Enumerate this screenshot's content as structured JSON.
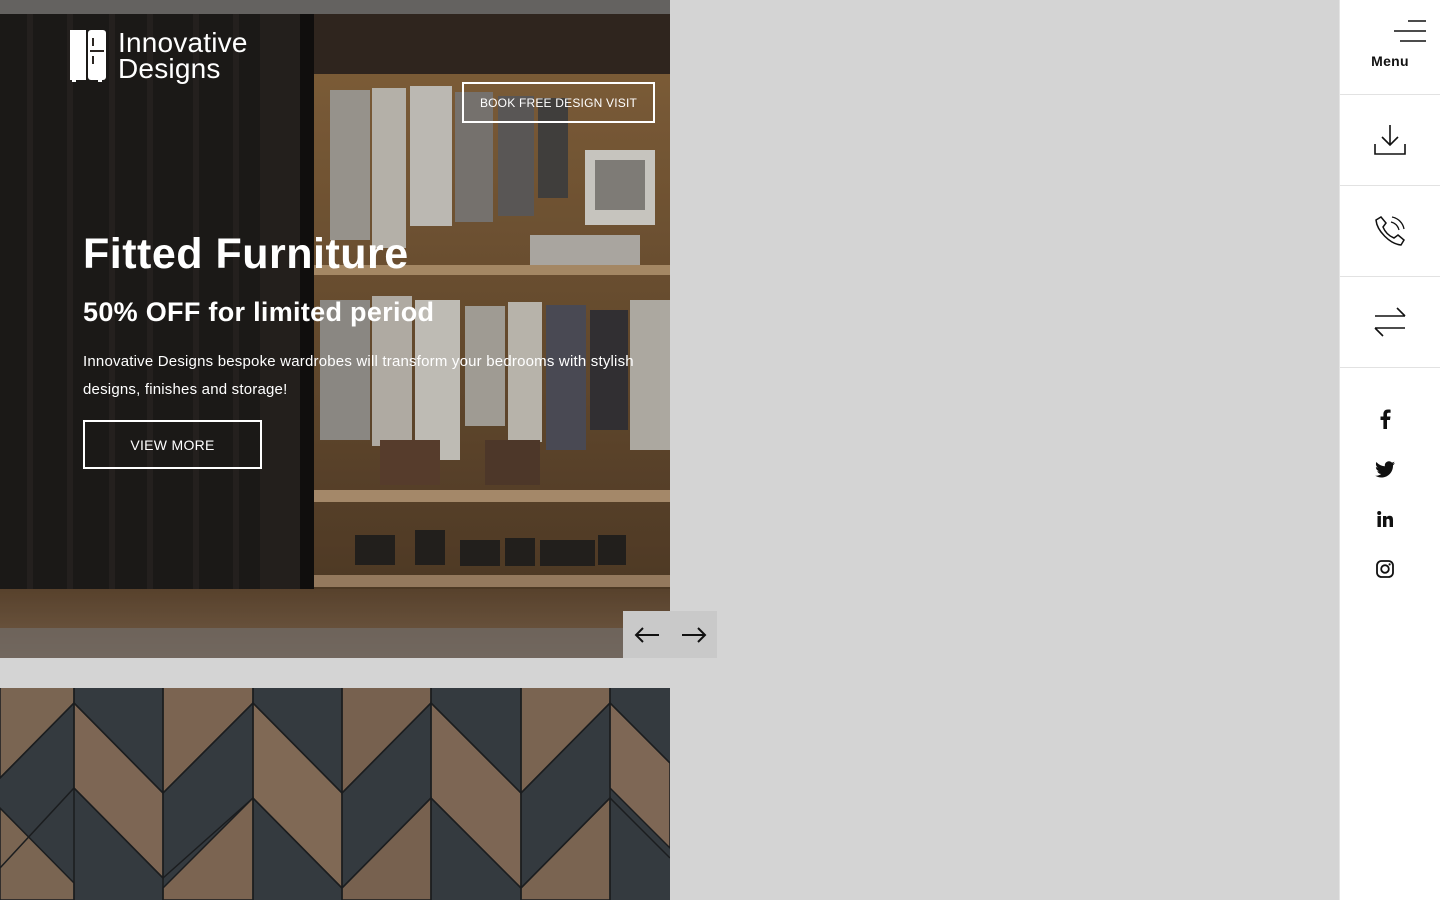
{
  "header": {
    "logo_line1": "Innovative",
    "logo_line2": "Designs",
    "book_button": "BOOK FREE DESIGN VISIT"
  },
  "hero": {
    "title": "Fitted Furniture",
    "subtitle": "50% OFF for limited period",
    "description": "Innovative Designs bespoke wardrobes will transform your bedrooms with stylish designs, finishes and storage!",
    "cta": "VIEW MORE"
  },
  "slider": {
    "prev_icon": "arrow-left-icon",
    "next_icon": "arrow-right-icon"
  },
  "sidebar": {
    "menu_label": "Menu",
    "buttons": [
      {
        "icon": "download-icon"
      },
      {
        "icon": "phone-icon"
      },
      {
        "icon": "compare-arrows-icon"
      }
    ],
    "socials": [
      {
        "icon": "facebook-icon"
      },
      {
        "icon": "twitter-icon"
      },
      {
        "icon": "linkedin-icon"
      },
      {
        "icon": "instagram-icon"
      }
    ]
  },
  "colors": {
    "page_background": "#d4d4d4",
    "sidebar_background": "#ffffff",
    "slider_nav": "#c9c9c9",
    "pattern_dark": "#343a3f",
    "pattern_wood": "#7d6654"
  }
}
